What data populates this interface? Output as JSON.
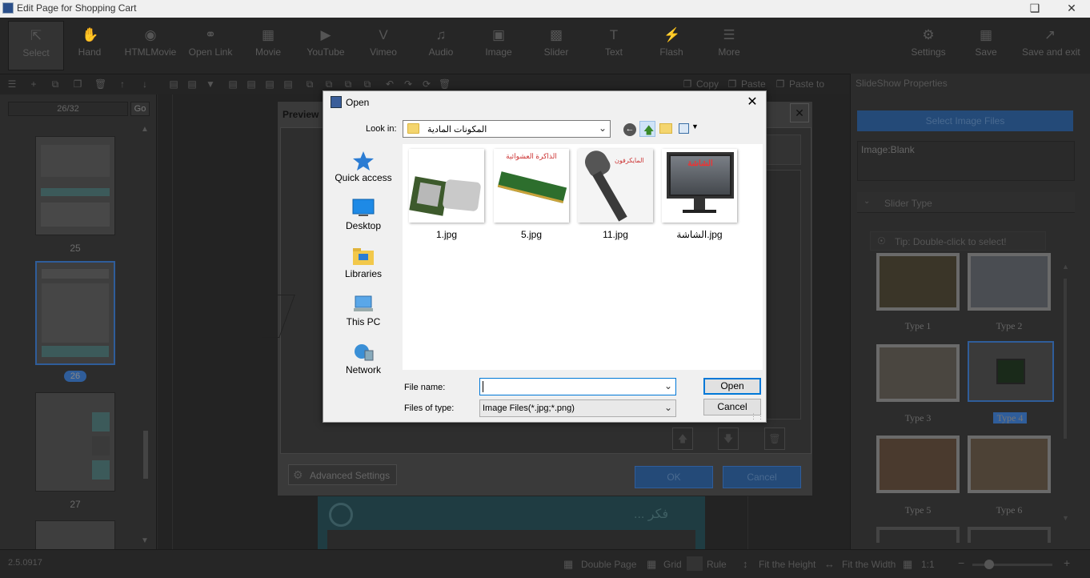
{
  "window": {
    "title": "Edit Page for Shopping Cart",
    "restore_icon": "restore-icon",
    "close_icon": "close-icon"
  },
  "toolbar": {
    "items": [
      {
        "label": "Select",
        "icon": "cursor-icon"
      },
      {
        "label": "Hand",
        "icon": "hand-icon"
      },
      {
        "label": "HTMLMovie",
        "icon": "film-reel-icon"
      },
      {
        "label": "Open Link",
        "icon": "link-icon"
      },
      {
        "label": "Movie",
        "icon": "movie-icon"
      },
      {
        "label": "YouTube",
        "icon": "youtube-icon"
      },
      {
        "label": "Vimeo",
        "icon": "vimeo-icon"
      },
      {
        "label": "Audio",
        "icon": "music-note-icon"
      },
      {
        "label": "Image",
        "icon": "image-icon"
      },
      {
        "label": "Slider",
        "icon": "slider-icon"
      },
      {
        "label": "Text",
        "icon": "text-icon"
      },
      {
        "label": "Flash",
        "icon": "flash-icon"
      },
      {
        "label": "More",
        "icon": "more-icon"
      }
    ],
    "right_items": [
      {
        "label": "Settings",
        "icon": "gear-icon"
      },
      {
        "label": "Save",
        "icon": "save-icon"
      },
      {
        "label": "Save and exit",
        "icon": "save-exit-icon"
      }
    ]
  },
  "toolbar2": {
    "copy": "Copy",
    "paste": "Paste",
    "paste_to": "Paste to"
  },
  "left_panel": {
    "page_indicator": "26/32",
    "go_label": "Go",
    "thumb_labels": [
      "25",
      "26",
      "27"
    ]
  },
  "right_panel": {
    "title": "SlideShow Properties",
    "select_btn": "Select Image Files",
    "image_label": "Image:Blank",
    "slider_type_header": "Slider Type",
    "tip": "Tip: Double-click to select!",
    "types": [
      "Type 1",
      "Type 2",
      "Type 3",
      "Type 4",
      "Type 5",
      "Type 6"
    ],
    "selected_type": "Type 4"
  },
  "preview": {
    "title": "Preview",
    "advanced_settings": "Advanced Settings",
    "ok": "OK",
    "cancel": "Cancel"
  },
  "canvas": {
    "arabic_title": "فكر ..."
  },
  "status": {
    "version": "2.5.0917",
    "double_page": "Double Page",
    "grid": "Grid",
    "rule": "Rule",
    "fit_height": "Fit the Height",
    "fit_width": "Fit the Width",
    "zoom": "1:1"
  },
  "open_dialog": {
    "title": "Open",
    "look_in_label": "Look in:",
    "look_in_value": "المكونات المادية",
    "places": [
      {
        "label": "Quick access",
        "icon": "star-icon"
      },
      {
        "label": "Desktop",
        "icon": "desktop-icon"
      },
      {
        "label": "Libraries",
        "icon": "libraries-icon"
      },
      {
        "label": "This PC",
        "icon": "computer-icon"
      },
      {
        "label": "Network",
        "icon": "network-icon"
      }
    ],
    "files": [
      {
        "name": "1.jpg",
        "caption": ""
      },
      {
        "name": "5.jpg",
        "caption": "الذاكرة العشوائية"
      },
      {
        "name": "11.jpg",
        "caption": "المايكرفون"
      },
      {
        "name": "الشاشة.jpg",
        "caption": "الشاشة"
      }
    ],
    "file_name_label": "File name:",
    "file_name_value": "",
    "files_of_type_label": "Files of type:",
    "files_of_type_value": "Image Files(*.jpg;*.png)",
    "open_btn": "Open",
    "cancel_btn": "Cancel"
  }
}
